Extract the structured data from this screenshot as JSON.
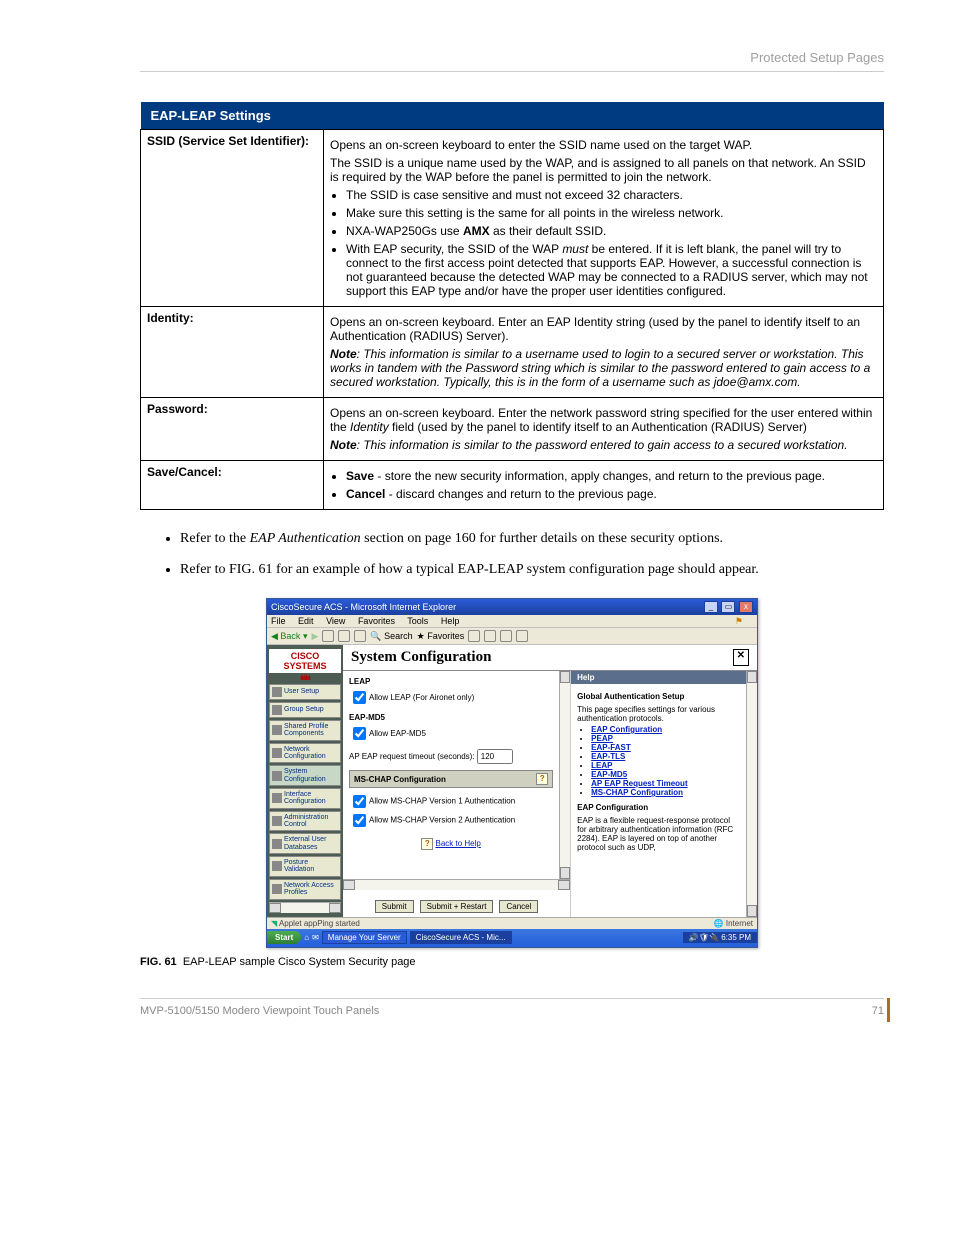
{
  "page_header": "Protected Setup Pages",
  "table_title": "EAP-LEAP Settings",
  "rows": {
    "ssid_label": "SSID (Service Set Identifier):",
    "ssid_p1": "Opens an on-screen keyboard to enter the SSID name used on the target WAP.",
    "ssid_p2": "The SSID is a unique name used by the WAP, and is assigned to all panels on that network. An SSID is required by the WAP before the panel is permitted to join the network.",
    "ssid_b1": "The SSID is case sensitive and must not exceed 32 characters.",
    "ssid_b2": "Make sure this setting is the same for all points in the wireless network.",
    "ssid_b3_a": "NXA-WAP250Gs use ",
    "ssid_b3_b": "AMX",
    "ssid_b3_c": " as their default SSID.",
    "ssid_b4_a": "With EAP security, the SSID of the WAP ",
    "ssid_b4_b": "must",
    "ssid_b4_c": " be entered. If it is left blank, the panel will try to connect to the first access point detected that supports EAP. However, a successful connection is not guaranteed because the detected WAP may be connected to a RADIUS server, which may not support this EAP type and/or have the proper user identities configured.",
    "identity_label": "Identity:",
    "id_p1": "Opens an on-screen keyboard. Enter an EAP Identity string (used by the panel to identify itself to an Authentication (RADIUS) Server).",
    "id_note_a": "Note",
    "id_note_b": ": This information is similar to a username used to login to a secured server or workstation. This works in tandem with the Password string which is similar to the password entered to gain access to a secured workstation. Typically, this is in the form of a username such as jdoe@amx.com.",
    "pw_label": "Password:",
    "pw_p1_a": "Opens an on-screen keyboard. Enter the network password string specified for the user entered within the ",
    "pw_p1_b": "Identity",
    "pw_p1_c": " field (used by the panel to identify itself to an Authentication (RADIUS) Server)",
    "pw_note_a": "Note",
    "pw_note_b": ": This information is similar to the password entered to gain access to a secured workstation.",
    "sc_label": "Save/Cancel:",
    "sc_b1_a": "Save",
    "sc_b1_b": " - store the new security information, apply changes, and return to the previous page.",
    "sc_b2_a": "Cancel",
    "sc_b2_b": " - discard changes and return to the previous page."
  },
  "bullet1_a": "Refer to the ",
  "bullet1_b": "EAP Authentication",
  "bullet1_c": " section on page 160 for further details on these security options.",
  "bullet2": "Refer to FIG. 61 for an example of how a typical EAP-LEAP system configuration page should appear.",
  "fig_label": "FIG. 61",
  "fig_caption": "EAP-LEAP sample Cisco System Security page",
  "footer_left": "MVP-5100/5150 Modero Viewpoint  Touch Panels",
  "footer_right": "71",
  "ie": {
    "title": "CiscoSecure ACS - Microsoft Internet Explorer",
    "menu": [
      "File",
      "Edit",
      "View",
      "Favorites",
      "Tools",
      "Help"
    ],
    "back": "Back",
    "search": "Search",
    "fav": "Favorites",
    "cisco": "CISCO SYSTEMS",
    "sidebar": [
      "User Setup",
      "Group Setup",
      "Shared Profile Components",
      "Network Configuration",
      "System Configuration",
      "Interface Configuration",
      "Administration Control",
      "External User Databases",
      "Posture Validation",
      "Network Access Profiles"
    ],
    "sys_title": "System Configuration",
    "leap_head": "LEAP",
    "leap_cb": "Allow LEAP (For Aironet only)",
    "eapmd5_head": "EAP-MD5",
    "eapmd5_cb": "Allow EAP-MD5",
    "ap_timeout": "AP EAP request timeout (seconds):",
    "ap_timeout_val": "120",
    "mschap_title": "MS-CHAP Configuration",
    "mschap_cb1": "Allow MS-CHAP Version 1 Authentication",
    "mschap_cb2": "Allow MS-CHAP Version 2 Authentication",
    "back_help": "Back to Help",
    "submit": "Submit",
    "submit_restart": "Submit + Restart",
    "cancel": "Cancel",
    "help": "Help",
    "help_topic": "Global Authentication Setup",
    "help_desc": "This page specifies settings for various authentication protocols.",
    "help_links": [
      "EAP Configuration",
      "PEAP",
      "EAP-FAST",
      "EAP-TLS",
      "LEAP",
      "EAP-MD5",
      "AP EAP Request Timeout",
      "MS-CHAP Configuration"
    ],
    "help_sec2_head": "EAP Configuration",
    "help_sec2_body": "EAP is a flexible request-response protocol for arbitrary authentication information (RFC 2284). EAP is layered on top of another protocol such as UDP,",
    "status_left": "Applet appPing started",
    "status_right": "Internet",
    "start": "Start",
    "task1": "Manage Your Server",
    "task2": "CiscoSecure ACS - Mic...",
    "clock": "6:35 PM"
  }
}
